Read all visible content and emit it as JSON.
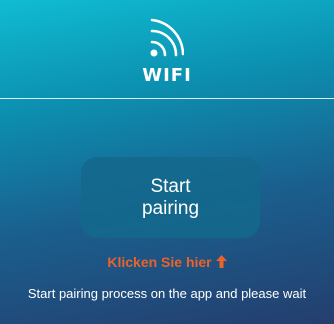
{
  "header": {
    "title": "WIFI",
    "icon": "wifi-icon"
  },
  "main": {
    "start_button_label": "Start pairing",
    "click_hint": "Klicken Sie hier",
    "click_hint_icon": "arrow-up-icon",
    "status_text": "Start pairing process on the app and please wait"
  },
  "colors": {
    "background_top": "#10bcd2",
    "background_bottom": "#243e6e",
    "button": "#14698c",
    "hint_accent": "#e9632a",
    "text": "#ffffff"
  }
}
